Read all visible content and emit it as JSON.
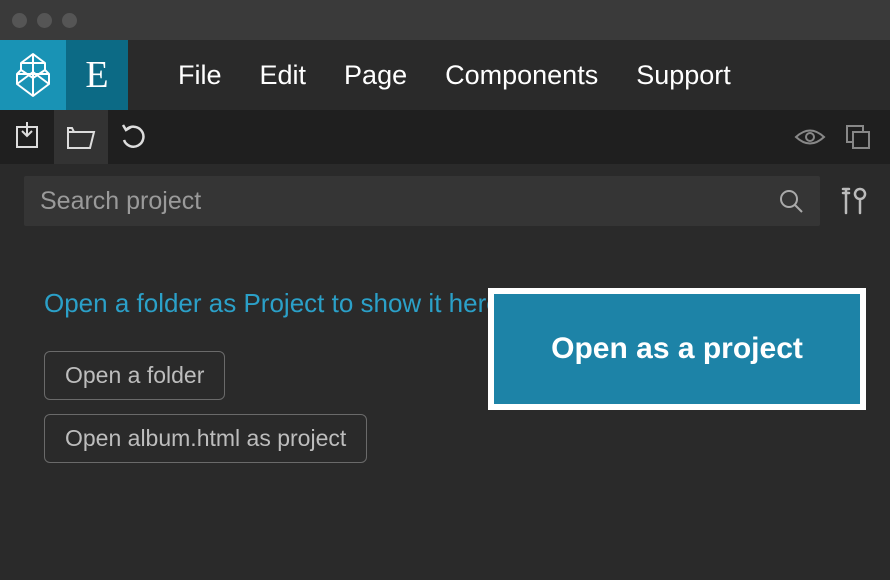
{
  "menu": {
    "items": [
      "File",
      "Edit",
      "Page",
      "Components",
      "Support"
    ],
    "mode_letter": "E"
  },
  "search": {
    "placeholder": "Search project"
  },
  "content": {
    "hint": "Open a folder as Project to show it here.",
    "open_folder_label": "Open a folder",
    "open_file_as_project_label": "Open album.html as project"
  },
  "callout": {
    "label": "Open as a project"
  }
}
